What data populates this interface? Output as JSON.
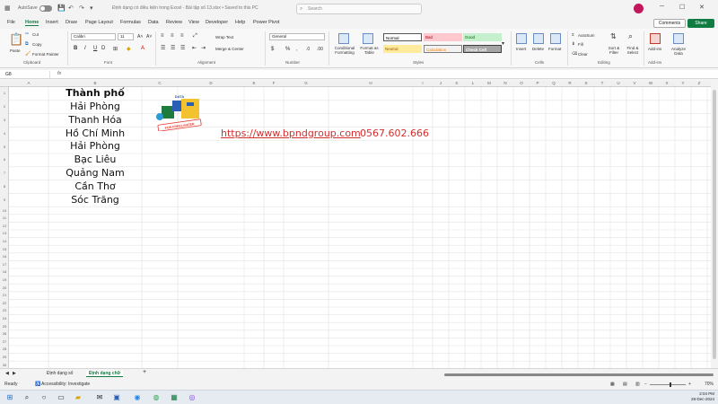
{
  "titlebar": {
    "autosave_label": "AutoSave",
    "doc_title": "Định dạng có điều kiện trong Excel - Bài tập số 13.xlsx • Saved to this PC",
    "search_placeholder": "Search"
  },
  "menu": {
    "tabs": [
      "File",
      "Home",
      "Insert",
      "Draw",
      "Page Layout",
      "Formulas",
      "Data",
      "Review",
      "View",
      "Developer",
      "Help",
      "Power Pivot"
    ],
    "active_tab": "Home",
    "comments_label": "Comments",
    "share_label": "Share"
  },
  "ribbon": {
    "clipboard": {
      "paste": "Paste",
      "cut": "Cut",
      "copy": "Copy",
      "format_painter": "Format Painter",
      "label": "Clipboard"
    },
    "font": {
      "name": "Calibri",
      "size": "11",
      "label": "Font"
    },
    "alignment": {
      "wrap_text": "Wrap Text",
      "merge_center": "Merge & Center",
      "label": "Alignment"
    },
    "number": {
      "format": "General",
      "label": "Number"
    },
    "styles": {
      "conditional_formatting": "Conditional Formatting",
      "format_as_table": "Format as Table",
      "cells": [
        {
          "label": "Normal",
          "bg": "#ffffff",
          "fg": "#000000"
        },
        {
          "label": "Bad",
          "bg": "#ffc7ce",
          "fg": "#9c0006"
        },
        {
          "label": "Good",
          "bg": "#c6efce",
          "fg": "#006100"
        },
        {
          "label": "Neutral",
          "bg": "#ffeb9c",
          "fg": "#9c5700"
        },
        {
          "label": "Calculation",
          "bg": "#f2f2f2",
          "fg": "#fa7d00"
        },
        {
          "label": "Check Cell",
          "bg": "#a5a5a5",
          "fg": "#ffffff"
        }
      ],
      "label": "Styles"
    },
    "cells": {
      "insert": "Insert",
      "delete": "Delete",
      "format": "Format",
      "label": "Cells"
    },
    "editing": {
      "autosum": "AutoSum",
      "fill": "Fill",
      "clear": "Clear",
      "sort_filter": "Sort & Filter",
      "find_select": "Find & Select",
      "label": "Editing"
    },
    "addins": {
      "addins": "Add-ins",
      "analyze": "Analyze Data",
      "label": "Add-ins"
    }
  },
  "formula_bar": {
    "name_box": "G8",
    "fx": "fx",
    "content": ""
  },
  "grid": {
    "columns": [
      "A",
      "B",
      "C",
      "D",
      "E",
      "F",
      "G",
      "H",
      "I",
      "J",
      "K",
      "L",
      "M",
      "N",
      "O",
      "P",
      "Q",
      "R",
      "S",
      "T",
      "U",
      "V",
      "W",
      "X",
      "Y",
      "Z",
      "AA",
      "AB",
      "AC"
    ],
    "rows": [
      "1",
      "2",
      "3",
      "4",
      "5",
      "6",
      "7",
      "8",
      "9",
      "10",
      "11",
      "12",
      "13",
      "14",
      "15",
      "16",
      "17",
      "18",
      "19",
      "20",
      "21",
      "22",
      "23",
      "24",
      "25",
      "26",
      "27",
      "28",
      "29",
      "30",
      "31",
      "32",
      "33",
      "34",
      "35"
    ],
    "header_cell": "Thành phố",
    "cities": [
      "Hải Phòng",
      "Thanh Hóa",
      "Hồ Chí Minh",
      "Hải Phòng",
      "Bạc Liêu",
      "Quảng Nam",
      "Cần Thơ",
      "Sóc Trăng"
    ],
    "link": "https://www.bpndgroup.com",
    "phone": "0567.602.666",
    "logo_text": {
      "top": "DATA",
      "bottom": "FOR FREELANCER"
    }
  },
  "sheets": {
    "tabs": [
      "Định dạng số",
      "Định dạng chữ"
    ],
    "active": "Định dạng chữ",
    "add": "+"
  },
  "status": {
    "ready": "Ready",
    "accessibility": "Accessibility: Investigate",
    "zoom": "70%"
  },
  "clock": {
    "time": "2:04 PM",
    "date": "28-Dec-2024"
  },
  "colors": {
    "accent": "#107c41",
    "link": "#d32f2f"
  }
}
